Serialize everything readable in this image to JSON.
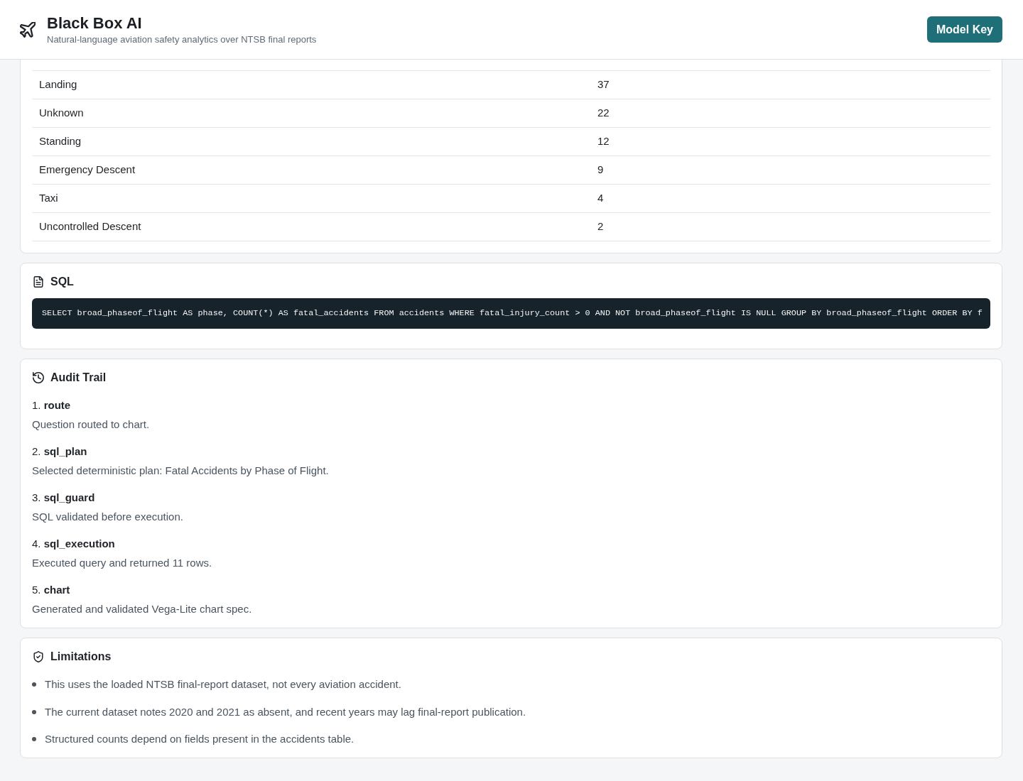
{
  "header": {
    "title": "Black Box AI",
    "subtitle": "Natural-language aviation safety analytics over NTSB final reports",
    "button": "Model Key"
  },
  "results_table": {
    "rows": [
      [
        "Landing",
        "37"
      ],
      [
        "Unknown",
        "22"
      ],
      [
        "Standing",
        "12"
      ],
      [
        "Emergency Descent",
        "9"
      ],
      [
        "Taxi",
        "4"
      ],
      [
        "Uncontrolled Descent",
        "2"
      ]
    ]
  },
  "sql": {
    "title": "SQL",
    "query": "SELECT broad_phaseof_flight AS phase, COUNT(*) AS fatal_accidents FROM accidents WHERE fatal_injury_count > 0 AND NOT broad_phaseof_flight IS NULL GROUP BY broad_phaseof_flight ORDER BY f"
  },
  "audit_trail": {
    "title": "Audit Trail",
    "steps": [
      {
        "heading": "1. **route**",
        "detail": "Question routed to chart."
      },
      {
        "heading": "2. **sql_plan**",
        "detail": "Selected deterministic plan: Fatal Accidents by Phase of Flight."
      },
      {
        "heading": "3. **sql_guard**",
        "detail": "SQL validated before execution."
      },
      {
        "heading": "4. **sql_execution**",
        "detail": "Executed query and returned 11 rows."
      },
      {
        "heading": "5. **chart**",
        "detail": "Generated and validated Vega-Lite chart spec."
      }
    ]
  },
  "limitations": {
    "title": "Limitations",
    "items": [
      "This uses the loaded NTSB final-report dataset, not every aviation accident.",
      "The current dataset notes 2020 and 2021 as absent, and recent years may lag final-report publication.",
      "Structured counts depend on fields present in the accidents table."
    ]
  }
}
